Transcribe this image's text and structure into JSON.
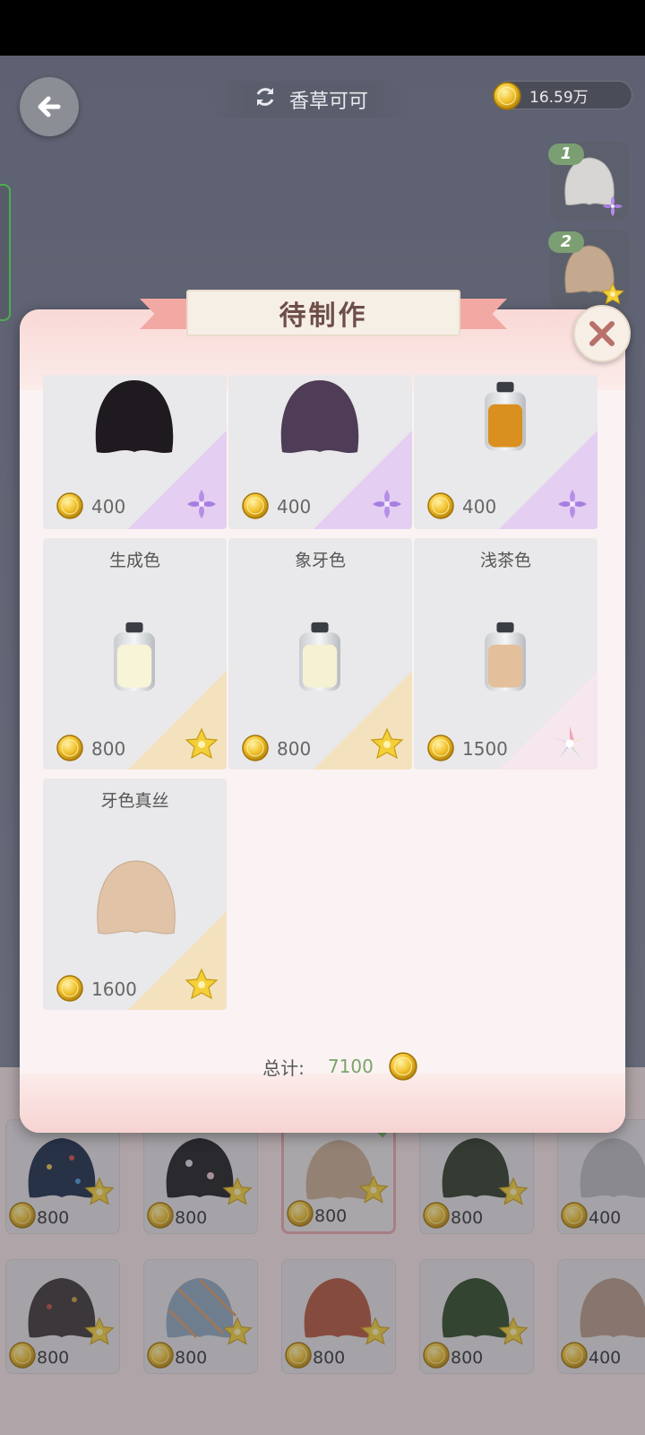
{
  "header": {
    "title": "香草可可",
    "coins": "16.59万"
  },
  "queue": [
    {
      "number": "1"
    },
    {
      "number": "2"
    }
  ],
  "modal": {
    "title": "待制作",
    "items": [
      {
        "name": "",
        "price": "400",
        "rarity": "purple"
      },
      {
        "name": "",
        "price": "400",
        "rarity": "purple"
      },
      {
        "name": "",
        "price": "400",
        "rarity": "purple"
      },
      {
        "name": "生成色",
        "price": "800",
        "rarity": "gold"
      },
      {
        "name": "象牙色",
        "price": "800",
        "rarity": "gold"
      },
      {
        "name": "浅茶色",
        "price": "1500",
        "rarity": "rainbow"
      },
      {
        "name": "牙色真丝",
        "price": "1600",
        "rarity": "gold"
      }
    ],
    "total_label": "总计:",
    "total_value": "7100"
  },
  "bottom_items": [
    {
      "price": "800"
    },
    {
      "price": "800"
    },
    {
      "price": "800"
    },
    {
      "price": "800"
    },
    {
      "price": "400"
    },
    {
      "price": "800"
    },
    {
      "price": "800"
    },
    {
      "price": "800"
    },
    {
      "price": "800"
    },
    {
      "price": "400"
    }
  ],
  "colors": {
    "coin": "#f2c12e",
    "total_value": "#7aa36a",
    "ribbon": "#f2a9a4",
    "selected_border": "#e8a8aa"
  }
}
